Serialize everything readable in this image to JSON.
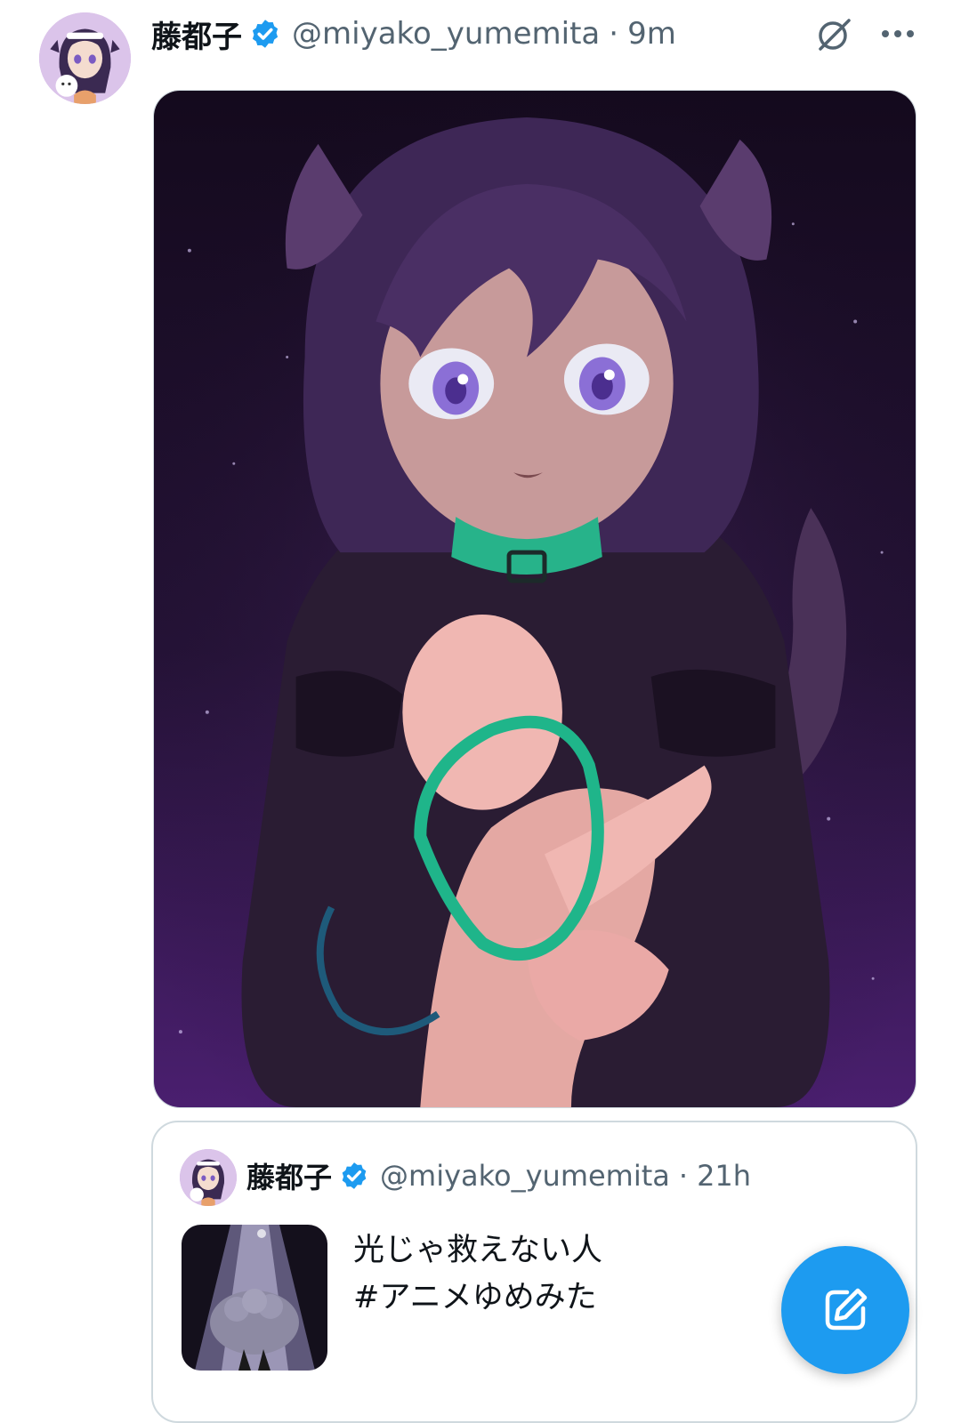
{
  "post": {
    "display_name": "藤都子",
    "handle": "@miyako_yumemita",
    "separator": "·",
    "time": "9m",
    "verified": true,
    "grok_icon": "grok-slash-circle-icon",
    "more_icon": "more-horizontal-icon",
    "media_alt": "Illustration of a dog-eared girl with a green collar handing over a leash"
  },
  "quoted_post": {
    "display_name": "藤都子",
    "handle": "@miyako_yumemita",
    "separator": "·",
    "time": "21h",
    "verified": true,
    "text_line1": "光じゃ救えない人",
    "text_line2": "#アニメゆめみた"
  },
  "compose_button": {
    "icon": "compose-pencil-icon"
  },
  "colors": {
    "accent": "#1d9bf0",
    "secondary_text": "#536471",
    "border": "#cfd9de",
    "verified_badge": "#1d9bf0"
  }
}
